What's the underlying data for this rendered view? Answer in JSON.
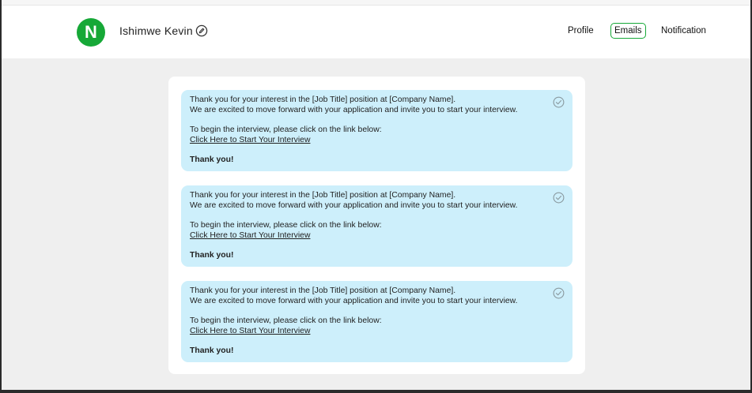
{
  "header": {
    "avatar_letter": "N",
    "user_name": "Ishimwe Kevin",
    "nav": {
      "profile": "Profile",
      "emails": "Emails",
      "notification": "Notification"
    }
  },
  "emails": [
    {
      "line1": "Thank you for your interest in the [Job Title] position at [Company Name].",
      "line2": "We are excited to move forward with your application and invite you to start your interview.",
      "line3": "To begin the interview, please click on the link below:",
      "link": "Click Here to Start Your Interview",
      "closing": "Thank you!"
    },
    {
      "line1": "Thank you for your interest in the [Job Title] position at [Company Name].",
      "line2": "We are excited to move forward with your application and invite you to start your interview.",
      "line3": "To begin the interview, please click on the link below:",
      "link": "Click Here to Start Your Interview",
      "closing": "Thank you!"
    },
    {
      "line1": "Thank you for your interest in the [Job Title] position at [Company Name].",
      "line2": "We are excited to move forward with your application and invite you to start your interview.",
      "line3": "To begin the interview, please click on the link below:",
      "link": "Click Here to Start Your Interview",
      "closing": "Thank you!"
    }
  ],
  "colors": {
    "accent": "#16a837",
    "card_bg": "#cdeffb",
    "page_bg": "#efefef"
  },
  "icons": {
    "edit": "edit-circle-icon",
    "check": "check-circle-icon"
  }
}
